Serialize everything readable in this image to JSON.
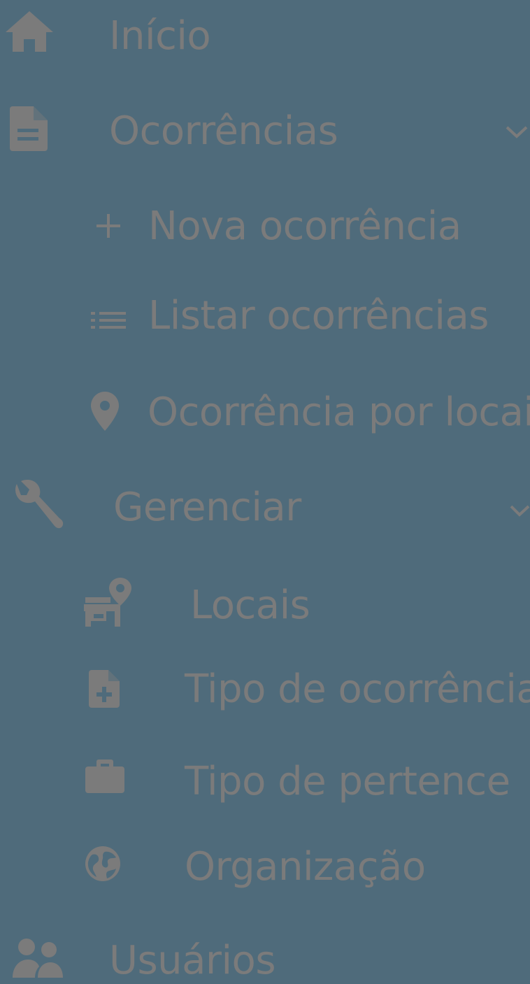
{
  "sidebar": {
    "items": [
      {
        "label": "Início",
        "icon": "home-icon"
      },
      {
        "label": "Ocorrências",
        "icon": "document-icon",
        "expanded": true,
        "children": [
          {
            "label": "Nova ocorrência",
            "icon": "plus-icon"
          },
          {
            "label": "Listar ocorrências",
            "icon": "list-icon"
          },
          {
            "label": "Ocorrência por locais",
            "icon": "map-pin-icon"
          }
        ]
      },
      {
        "label": "Gerenciar",
        "icon": "wrench-icon",
        "expanded": true,
        "children": [
          {
            "label": "Locais",
            "icon": "store-location-icon"
          },
          {
            "label": "Tipo de ocorrência",
            "icon": "file-plus-icon"
          },
          {
            "label": "Tipo de pertence",
            "icon": "briefcase-icon"
          },
          {
            "label": "Organização",
            "icon": "globe-icon"
          }
        ]
      },
      {
        "label": "Usuários",
        "icon": "users-icon"
      }
    ]
  },
  "colors": {
    "background": "#4f6b7b",
    "text": "#7b7b7b",
    "icon": "#7b7b7b"
  }
}
